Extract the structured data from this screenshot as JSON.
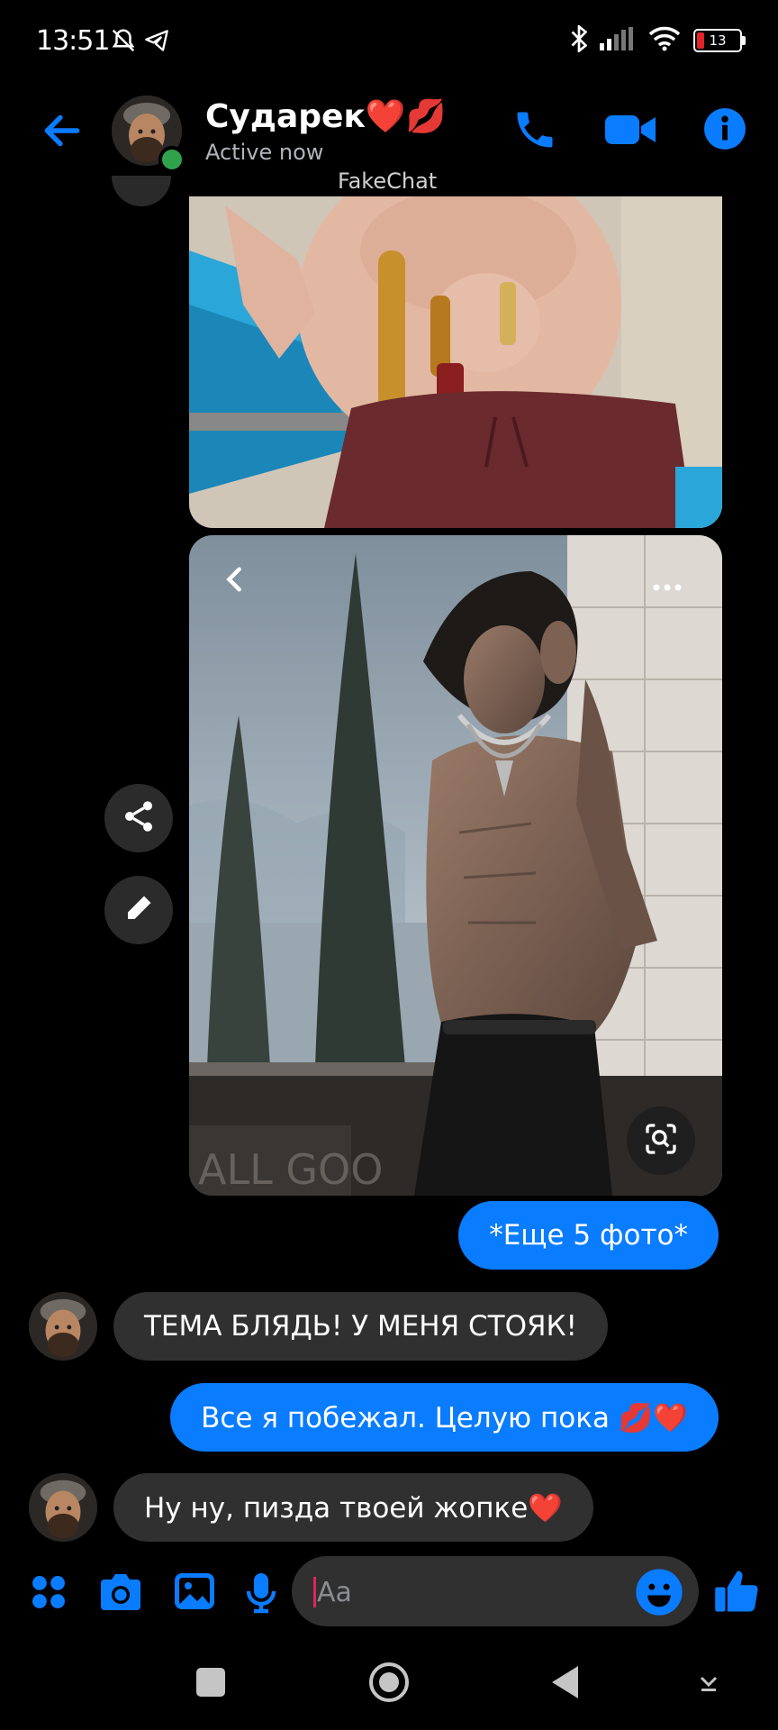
{
  "status_bar": {
    "time": "13:51",
    "battery": "13"
  },
  "header": {
    "name": "Сударек❤️💋",
    "status": "Active now",
    "watermark": "FakeChat"
  },
  "colors": {
    "accent": "#0a7cff",
    "online": "#31a24c",
    "incoming_bubble": "#303030"
  },
  "media": [
    {
      "name": "photo-1",
      "description_icon": "image"
    },
    {
      "name": "photo-2",
      "overlay_text": "ALL GOO"
    }
  ],
  "messages": [
    {
      "direction": "out",
      "text": "*Еще 5 фото*"
    },
    {
      "direction": "in",
      "text": "ТЕМА БЛЯДЬ! У МЕНЯ СТОЯК!"
    },
    {
      "direction": "out",
      "text": "Все я побежал. Целую пока 💋❤️"
    },
    {
      "direction": "in",
      "text": "Ну ну, пизда твоей жопке❤️"
    }
  ],
  "composer": {
    "placeholder": "Aa"
  },
  "icons": {
    "header": [
      "back-arrow-icon",
      "phone-icon",
      "video-camera-icon",
      "info-icon"
    ],
    "composer": [
      "apps-grid-icon",
      "camera-icon",
      "gallery-icon",
      "microphone-icon",
      "emoji-icon",
      "thumbs-up-icon"
    ],
    "nav": [
      "recents-square-icon",
      "home-circle-icon",
      "back-triangle-icon",
      "keyboard-hide-icon"
    ]
  }
}
